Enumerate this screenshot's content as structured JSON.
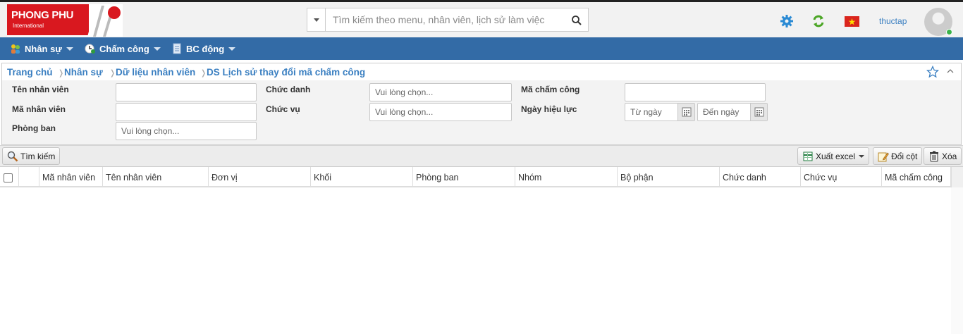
{
  "header": {
    "logo": {
      "brand": "PHONG PHU",
      "sub": "International"
    },
    "search": {
      "placeholder": "Tìm kiếm theo menu, nhân viên, lịch sử làm việc"
    },
    "username": "thuctap"
  },
  "nav": {
    "items": [
      {
        "label": "Nhân sự"
      },
      {
        "label": "Chấm công"
      },
      {
        "label": "BC động"
      }
    ]
  },
  "breadcrumb": {
    "items": [
      "Trang chủ",
      "Nhân sự",
      "Dữ liệu nhân viên",
      "DS Lịch sử thay đổi mã chấm công"
    ]
  },
  "filters": {
    "ten_nhan_vien": {
      "label": "Tên nhân viên",
      "value": ""
    },
    "ma_nhan_vien": {
      "label": "Mã nhân viên",
      "value": ""
    },
    "phong_ban": {
      "label": "Phòng ban",
      "placeholder": "Vui lòng chọn..."
    },
    "chuc_danh": {
      "label": "Chức danh",
      "placeholder": "Vui lòng chọn..."
    },
    "chuc_vu": {
      "label": "Chức vụ",
      "placeholder": "Vui lòng chọn..."
    },
    "ma_cham_cong": {
      "label": "Mã chấm công",
      "value": ""
    },
    "ngay_hieu_luc": {
      "label": "Ngày hiệu lực",
      "from_placeholder": "Từ ngày",
      "to_placeholder": "Đến ngày"
    }
  },
  "toolbar": {
    "search_label": "Tìm kiếm",
    "export_label": "Xuất excel",
    "columns_label": "Đổi cột",
    "delete_label": "Xóa"
  },
  "grid": {
    "columns": [
      "Mã nhân viên",
      "Tên nhân viên",
      "Đơn vị",
      "Khối",
      "Phòng ban",
      "Nhóm",
      "Bộ phận",
      "Chức danh",
      "Chức vụ",
      "Mã chấm công"
    ],
    "rows": []
  },
  "colors": {
    "nav_bg": "#336ba6",
    "brand_red": "#d9181f",
    "link_blue": "#3a7fc1"
  }
}
